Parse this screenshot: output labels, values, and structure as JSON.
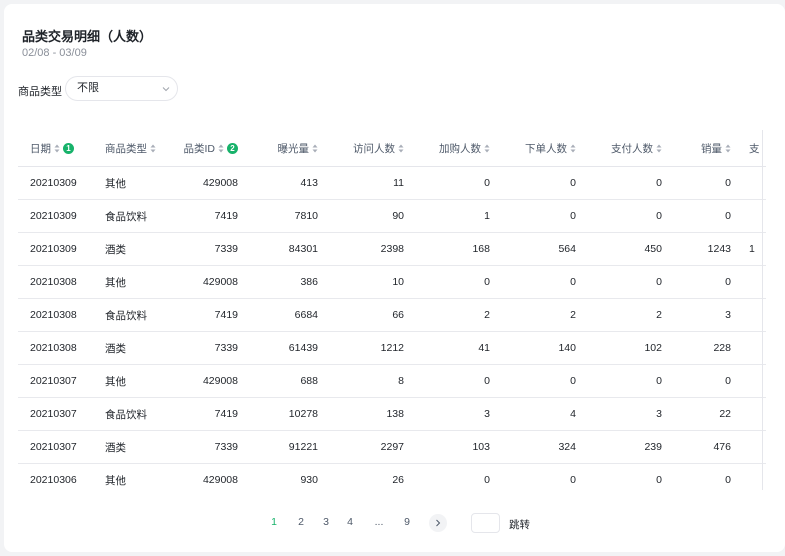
{
  "report": {
    "title": "品类交易明细（人数）",
    "date_range": "02/08 - 03/09"
  },
  "filter": {
    "label": "商品类型",
    "value": "不限"
  },
  "table": {
    "columns": [
      {
        "label": "日期",
        "badge": "1",
        "align": "l"
      },
      {
        "label": "商品类型",
        "badge": "",
        "align": "l"
      },
      {
        "label": "品类ID",
        "badge": "2",
        "align": "r"
      },
      {
        "label": "曝光量",
        "badge": "",
        "align": "r"
      },
      {
        "label": "访问人数",
        "badge": "",
        "align": "r"
      },
      {
        "label": "加购人数",
        "badge": "",
        "align": "r"
      },
      {
        "label": "下单人数",
        "badge": "",
        "align": "r"
      },
      {
        "label": "支付人数",
        "badge": "",
        "align": "r"
      },
      {
        "label": "销量",
        "badge": "",
        "align": "r"
      },
      {
        "label": "支",
        "badge": "",
        "align": "l"
      }
    ],
    "rows": [
      [
        "20210309",
        "其他",
        "429008",
        "413",
        "11",
        "0",
        "0",
        "0",
        "0",
        ""
      ],
      [
        "20210309",
        "食品饮料",
        "7419",
        "7810",
        "90",
        "1",
        "0",
        "0",
        "0",
        ""
      ],
      [
        "20210309",
        "酒类",
        "7339",
        "84301",
        "2398",
        "168",
        "564",
        "450",
        "1243",
        "1"
      ],
      [
        "20210308",
        "其他",
        "429008",
        "386",
        "10",
        "0",
        "0",
        "0",
        "0",
        ""
      ],
      [
        "20210308",
        "食品饮料",
        "7419",
        "6684",
        "66",
        "2",
        "2",
        "2",
        "3",
        ""
      ],
      [
        "20210308",
        "酒类",
        "7339",
        "61439",
        "1212",
        "41",
        "140",
        "102",
        "228",
        ""
      ],
      [
        "20210307",
        "其他",
        "429008",
        "688",
        "8",
        "0",
        "0",
        "0",
        "0",
        ""
      ],
      [
        "20210307",
        "食品饮料",
        "7419",
        "10278",
        "138",
        "3",
        "4",
        "3",
        "22",
        ""
      ],
      [
        "20210307",
        "酒类",
        "7339",
        "91221",
        "2297",
        "103",
        "324",
        "239",
        "476",
        ""
      ],
      [
        "20210306",
        "其他",
        "429008",
        "930",
        "26",
        "0",
        "0",
        "0",
        "0",
        ""
      ]
    ]
  },
  "pagination": {
    "pages": [
      "1",
      "2",
      "3",
      "4",
      "...",
      "9"
    ],
    "current": "1",
    "next_icon": "chevron-right-icon",
    "jump_label": "跳转"
  },
  "colors": {
    "accent": "#17b26a",
    "background": "#f2f3f5",
    "border": "#e5e6eb"
  }
}
